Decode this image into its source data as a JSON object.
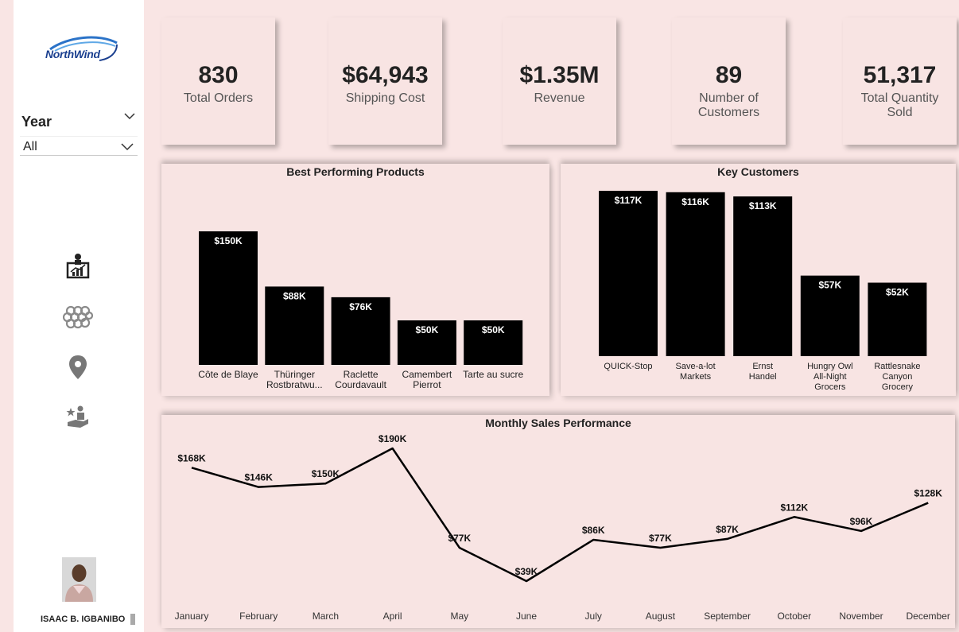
{
  "sidebar": {
    "logo_text": "NorthWind",
    "year_label": "Year",
    "year_value": "All",
    "nav_icons": [
      "presentation-chart-icon",
      "network-grid-icon",
      "location-pin-icon",
      "customer-hand-icon"
    ],
    "author": "ISAAC B. IGBANIBO"
  },
  "kpis": [
    {
      "value": "830",
      "label": "Total Orders"
    },
    {
      "value": "$64,943",
      "label": "Shipping Cost"
    },
    {
      "value": "$1.35M",
      "label": "Revenue"
    },
    {
      "value": "89",
      "label": "Number of Customers"
    },
    {
      "value": "51,317",
      "label": "Total Quantity Sold"
    }
  ],
  "chart_data": [
    {
      "type": "bar",
      "title": "Best Performing Products",
      "categories": [
        "Côte de Blaye",
        "Thüringer Rostbratwu...",
        "Raclette Courdavault",
        "Camembert Pierrot",
        "Tarte au sucre"
      ],
      "values": [
        150,
        88,
        76,
        50,
        50
      ],
      "data_labels": [
        "$150K",
        "$88K",
        "$76K",
        "$50K",
        "$50K"
      ],
      "ylim": [
        0,
        150
      ],
      "bar_color": "#000000"
    },
    {
      "type": "bar",
      "title": "Key Customers",
      "categories": [
        "QUICK-Stop",
        "Save-a-lot Markets",
        "Ernst Handel",
        "Hungry Owl All-Night Grocers",
        "Rattlesnake Canyon Grocery"
      ],
      "values": [
        117,
        116,
        113,
        57,
        52
      ],
      "data_labels": [
        "$117K",
        "$116K",
        "$113K",
        "$57K",
        "$52K"
      ],
      "ylim": [
        0,
        117
      ],
      "bar_color": "#000000"
    },
    {
      "type": "line",
      "title": "Monthly Sales Performance",
      "categories": [
        "January",
        "February",
        "March",
        "April",
        "May",
        "June",
        "July",
        "August",
        "September",
        "October",
        "November",
        "December"
      ],
      "values": [
        168,
        146,
        150,
        190,
        77,
        39,
        86,
        77,
        87,
        112,
        96,
        128
      ],
      "data_labels": [
        "$168K",
        "$146K",
        "$150K",
        "$190K",
        "$77K",
        "$39K",
        "$86K",
        "$77K",
        "$87K",
        "$112K",
        "$96K",
        "$128K"
      ],
      "ylim": [
        39,
        190
      ],
      "line_color": "#000000"
    }
  ]
}
